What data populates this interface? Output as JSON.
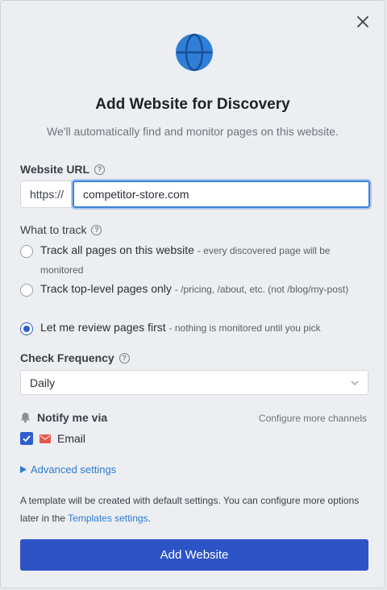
{
  "dialog": {
    "title": "Add Website for Discovery",
    "subtitle": "We'll automatically find and monitor pages on this website.",
    "close_icon": "close-icon",
    "header_icon": "globe-icon"
  },
  "website_url": {
    "label": "Website URL",
    "prefix": "https://",
    "value": "competitor-store.com"
  },
  "what_to_track": {
    "label": "What to track",
    "options": [
      {
        "title": "Track all pages on this website",
        "desc": "- every discovered page will be monitored",
        "checked": false
      },
      {
        "title": "Track top-level pages only",
        "desc": "- /pricing, /about, etc. (not /blog/my-post)",
        "checked": false
      },
      {
        "title": "Let me review pages first",
        "desc": "- nothing is monitored until you pick",
        "checked": true
      }
    ]
  },
  "check_frequency": {
    "label": "Check Frequency",
    "selected": "Daily"
  },
  "notify": {
    "label": "Notify me via",
    "configure_link": "Configure more channels",
    "email_label": "Email",
    "email_checked": true
  },
  "advanced": {
    "label": "Advanced settings"
  },
  "note": {
    "text_before": "A template will be created with default settings. You can configure more options later in the ",
    "link": "Templates settings",
    "text_after": "."
  },
  "submit_label": "Add Website",
  "colors": {
    "accent": "#2d54c6",
    "link": "#2b7bd3",
    "focus": "#3a82d8",
    "globe": "#2f7fd6",
    "mail": "#e8574b"
  }
}
